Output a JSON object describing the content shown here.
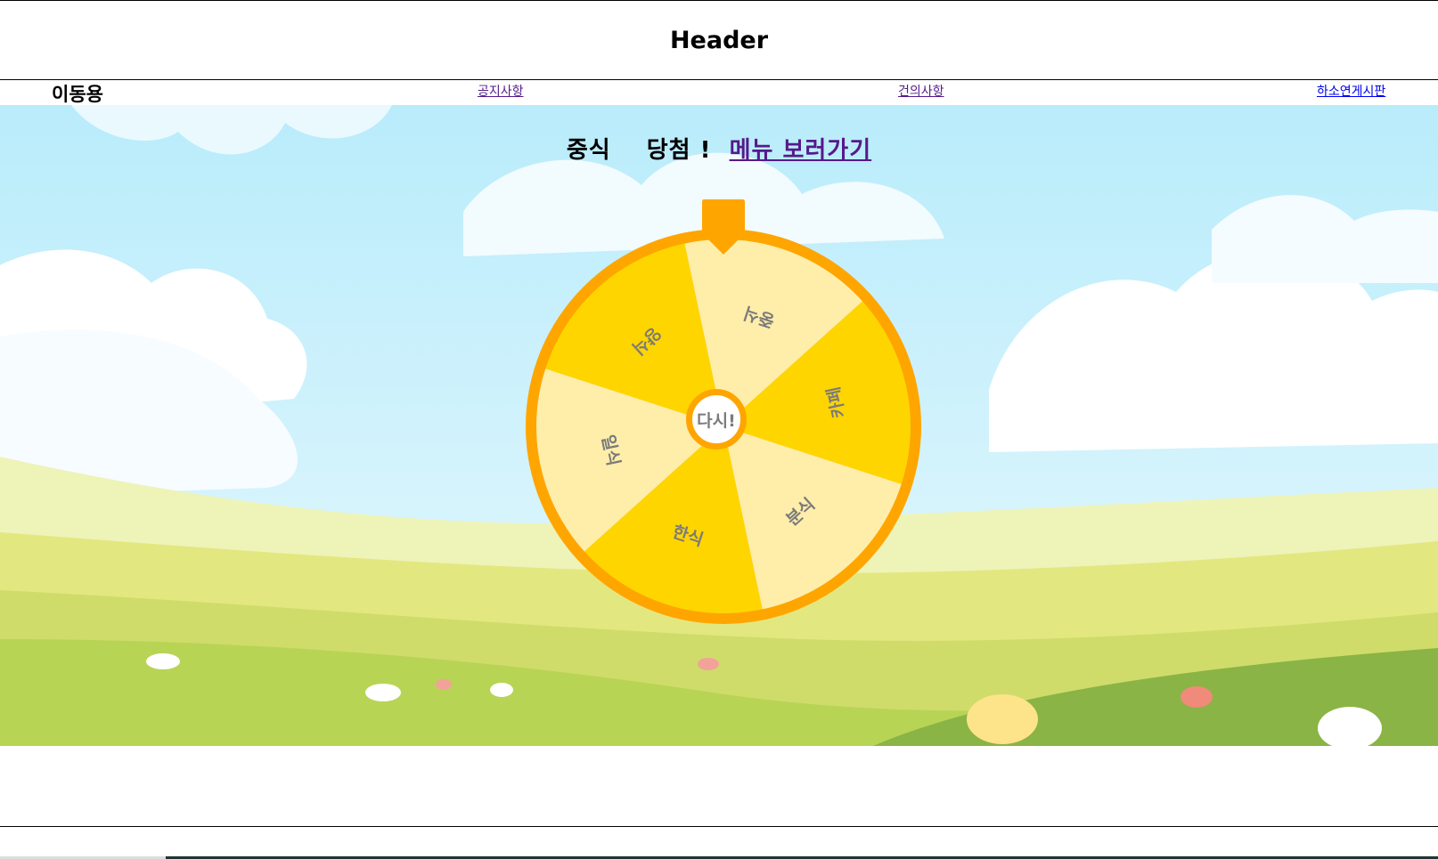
{
  "header": {
    "title": "Header"
  },
  "nav": {
    "user_name": "이동용",
    "links": [
      "공지사항",
      "건의사항",
      "하소연게시판"
    ]
  },
  "result": {
    "winner": "중식",
    "won_text": "당첨 !",
    "menu_link": "메뉴 보러가기"
  },
  "wheel": {
    "segments": [
      "중식",
      "카페",
      "분식",
      "한식",
      "일식",
      "양식"
    ],
    "respin_label": "다시!",
    "colors": {
      "ring": "#ffa500",
      "dark": "#ffd500",
      "light": "#ffeeaa",
      "text": "#7b7b7b"
    }
  }
}
